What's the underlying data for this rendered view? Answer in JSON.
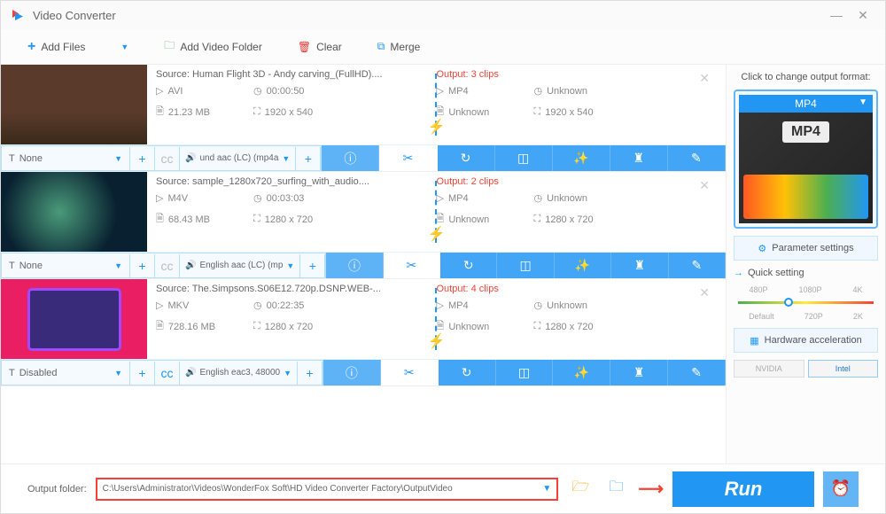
{
  "title": "Video Converter",
  "toolbar": {
    "add_files": "Add Files",
    "add_folder": "Add Video Folder",
    "clear": "Clear",
    "merge": "Merge"
  },
  "items": [
    {
      "source_label": "Source: Human Flight 3D - Andy carving_(FullHD)....",
      "output_label": "Output: 3 clips",
      "src_format": "AVI",
      "src_duration": "00:00:50",
      "src_size": "21.23 MB",
      "src_res": "1920 x 540",
      "out_format": "MP4",
      "out_duration": "Unknown",
      "out_size": "Unknown",
      "out_res": "1920 x 540",
      "subtitle": "None",
      "cc_enabled": false,
      "audio": "und aac (LC) (mp4a"
    },
    {
      "source_label": "Source: sample_1280x720_surfing_with_audio....",
      "output_label": "Output: 2 clips",
      "src_format": "M4V",
      "src_duration": "00:03:03",
      "src_size": "68.43 MB",
      "src_res": "1280 x 720",
      "out_format": "MP4",
      "out_duration": "Unknown",
      "out_size": "Unknown",
      "out_res": "1280 x 720",
      "subtitle": "None",
      "cc_enabled": false,
      "audio": "English aac (LC) (mp"
    },
    {
      "source_label": "Source: The.Simpsons.S06E12.720p.DSNP.WEB-...",
      "output_label": "Output: 4 clips",
      "src_format": "MKV",
      "src_duration": "00:22:35",
      "src_size": "728.16 MB",
      "src_res": "1280 x 720",
      "out_format": "MP4",
      "out_duration": "Unknown",
      "out_size": "Unknown",
      "out_res": "1280 x 720",
      "subtitle": "Disabled",
      "cc_enabled": true,
      "audio": "English eac3, 48000"
    }
  ],
  "sidebar": {
    "title": "Click to change output format:",
    "format": "MP4",
    "format_badge": "MP4",
    "param_settings": "Parameter settings",
    "quick": "Quick setting",
    "hw_accel": "Hardware acceleration",
    "nvidia": "NVIDIA",
    "intel": "Intel",
    "marks_top": [
      "480P",
      "1080P",
      "4K"
    ],
    "marks_bottom": [
      "Default",
      "720P",
      "2K"
    ]
  },
  "bottom": {
    "label": "Output folder:",
    "path": "C:\\Users\\Administrator\\Videos\\WonderFox Soft\\HD Video Converter Factory\\OutputVideo",
    "run": "Run"
  }
}
